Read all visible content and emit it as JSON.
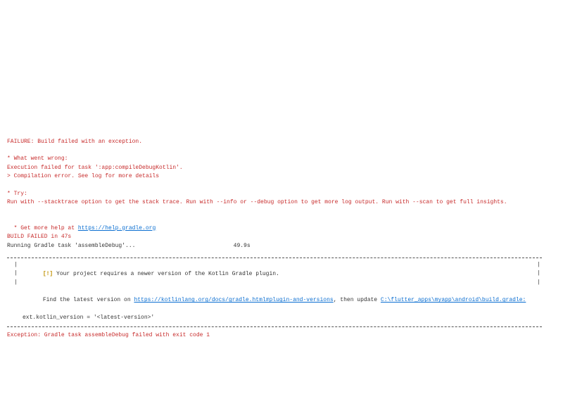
{
  "failure_header": "FAILURE: Build failed with an exception.",
  "section_wrong": "* What went wrong:",
  "wrong_line": "Execution failed for task ':app:compileDebugKotlin'.",
  "wrong_detail": "> Compilation error. See log for more details",
  "section_try": "* Try:",
  "try_line": "Run with --stacktrace option to get the stack trace. Run with --info or --debug option to get more log output. Run with --scan to get full insights.",
  "section_help_prefix": "* Get more help at ",
  "help_url": "https://help.gradle.org",
  "build_failed": "BUILD FAILED in 47s",
  "running_task": "Running Gradle task 'assembleDebug'...                             49.9s",
  "box": {
    "warn_badge": "[!]",
    "line1": " Your project requires a newer version of the Kotlin Gradle plugin.",
    "line2_pre": "Find the latest version on ",
    "line2_url": "https://kotlinlang.org/docs/gradle.html#plugin-and-versions",
    "line2_mid": ", then update ",
    "line2_path": "C:\\flutter_apps\\myapp\\android\\build.gradle:",
    "line3": "ext.kotlin_version = '<latest-version>'"
  },
  "exception_line": "Exception: Gradle task assembleDebug failed with exit code 1"
}
